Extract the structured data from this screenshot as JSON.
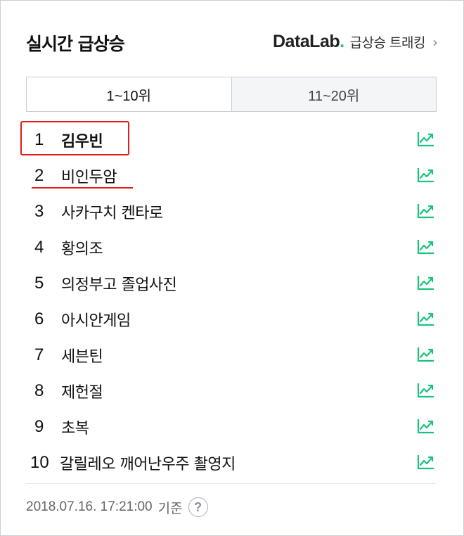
{
  "header": {
    "title": "실시간 급상승",
    "datalab_logo": "DataLab",
    "datalab_dot": ".",
    "datalab_sub": "급상승 트래킹",
    "chevron": "›"
  },
  "tabs": [
    {
      "label": "1~10위",
      "active": true
    },
    {
      "label": "11~20위",
      "active": false
    }
  ],
  "rankings": [
    {
      "rank": "1",
      "keyword": "김우빈"
    },
    {
      "rank": "2",
      "keyword": "비인두암"
    },
    {
      "rank": "3",
      "keyword": "사카구치 켄타로"
    },
    {
      "rank": "4",
      "keyword": "황의조"
    },
    {
      "rank": "5",
      "keyword": "의정부고 졸업사진"
    },
    {
      "rank": "6",
      "keyword": "아시안게임"
    },
    {
      "rank": "7",
      "keyword": "세븐틴"
    },
    {
      "rank": "8",
      "keyword": "제헌절"
    },
    {
      "rank": "9",
      "keyword": "초복"
    },
    {
      "rank": "10",
      "keyword": "갈릴레오 깨어난우주 촬영지"
    }
  ],
  "footer": {
    "timestamp": "2018.07.16. 17:21:00",
    "basis": "기준",
    "help": "?"
  },
  "colors": {
    "accent_green": "#19c37d",
    "highlight_red": "#e31b1b",
    "border": "#c9ced6"
  },
  "icons": {
    "trend": "trend-chart-icon",
    "help": "question-circle-icon",
    "chevron": "chevron-right-icon"
  }
}
